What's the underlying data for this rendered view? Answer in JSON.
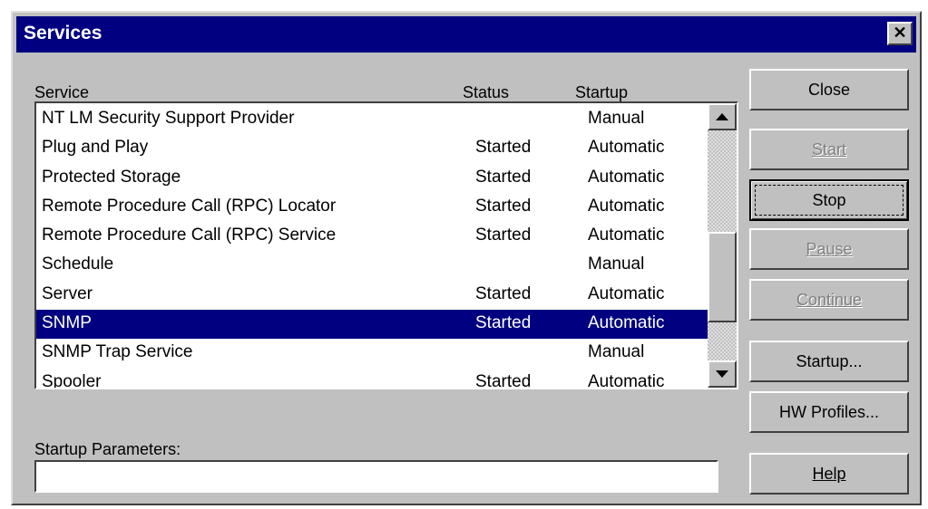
{
  "window": {
    "title": "Services",
    "close_glyph": "✕"
  },
  "columns": {
    "service": "Service",
    "status": "Status",
    "startup": "Startup"
  },
  "services": [
    {
      "name": "NT LM Security Support Provider",
      "status": "",
      "startup": "Manual"
    },
    {
      "name": "Plug and Play",
      "status": "Started",
      "startup": "Automatic"
    },
    {
      "name": "Protected Storage",
      "status": "Started",
      "startup": "Automatic"
    },
    {
      "name": "Remote Procedure Call (RPC) Locator",
      "status": "Started",
      "startup": "Automatic"
    },
    {
      "name": "Remote Procedure Call (RPC) Service",
      "status": "Started",
      "startup": "Automatic"
    },
    {
      "name": "Schedule",
      "status": "",
      "startup": "Manual"
    },
    {
      "name": "Server",
      "status": "Started",
      "startup": "Automatic"
    },
    {
      "name": "SNMP",
      "status": "Started",
      "startup": "Automatic",
      "selected": true
    },
    {
      "name": "SNMP Trap Service",
      "status": "",
      "startup": "Manual"
    },
    {
      "name": "Spooler",
      "status": "Started",
      "startup": "Automatic"
    }
  ],
  "startup_parameters": {
    "label": "Startup Parameters:",
    "value": ""
  },
  "buttons": {
    "close": "Close",
    "start": "Start",
    "stop": "Stop",
    "pause": "Pause",
    "continue": "Continue",
    "startup": "Startup...",
    "hw_profiles": "HW Profiles...",
    "help": "Help"
  },
  "colors": {
    "title_bar": "#000080",
    "face": "#c0c0c0",
    "selection": "#000080"
  }
}
